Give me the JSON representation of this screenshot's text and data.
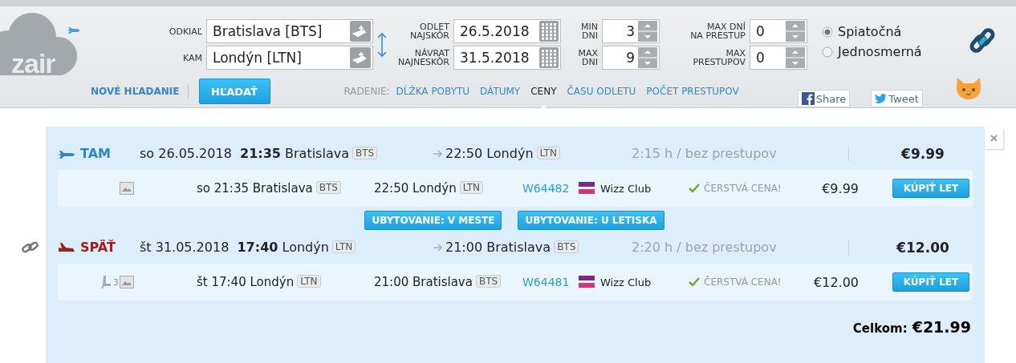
{
  "logo": {
    "text": "zair"
  },
  "route": [
    {
      "label": "ODKIAĽ",
      "value": "Bratislava [BTS]"
    },
    {
      "label": "KAM",
      "value": "Londýn [LTN]"
    }
  ],
  "dates": [
    {
      "label_lines": [
        "ODLET",
        "NAJSKÔR"
      ],
      "value": "26.5.2018"
    },
    {
      "label_lines": [
        "NÁVRAT",
        "NAJNESKÔR"
      ],
      "value": "31.5.2018"
    }
  ],
  "days": [
    {
      "label_lines": [
        "MIN",
        "DNI"
      ],
      "value": "3"
    },
    {
      "label_lines": [
        "MAX",
        "DNI"
      ],
      "value": "9"
    }
  ],
  "transfers": [
    {
      "label_lines": [
        "MAX DNÍ",
        "NA PRESTUP"
      ],
      "value": "0"
    },
    {
      "label_lines": [
        "MAX",
        "PRESTUPOV"
      ],
      "value": "0"
    }
  ],
  "trip_type": [
    {
      "label": "Spiatočná",
      "selected": true
    },
    {
      "label": "Jednosmerná",
      "selected": false
    }
  ],
  "new_search": "NOVÉ HĽADANIE",
  "search_button": "HĽADAŤ",
  "sorting": {
    "label": "RADENIE:",
    "options": [
      {
        "label": "DĹŽKA POBYTU",
        "selected": false
      },
      {
        "label": "DÁTUMY",
        "selected": false
      },
      {
        "label": "CENY",
        "selected": true
      },
      {
        "label": "ČASU ODLETU",
        "selected": false
      },
      {
        "label": "POČET PRESTUPOV",
        "selected": false
      }
    ]
  },
  "share": {
    "facebook": "Share",
    "twitter": "Tweet"
  },
  "results": {
    "close": "×",
    "items": [
      {
        "kind": "leg",
        "outbound": true,
        "label": "TAM",
        "date": "so 26.05.2018",
        "time": "21:35",
        "from": "Bratislava",
        "from_code": "BTS",
        "arrival": "22:50 Londýn",
        "to_code": "LTN",
        "duration": "2:15 h / bez prestupov",
        "price": "€9.99",
        "flights": [
          {
            "departure": "so 21:35 Bratislava",
            "from_code": "BTS",
            "arrival": "22:50 Londýn",
            "to_code": "LTN",
            "flight_no": "W64482",
            "airline": "Wizz Club",
            "status": "ČERSTVÁ CENA!",
            "price": "€9.99",
            "buy": "KÚPIŤ LET"
          }
        ]
      },
      {
        "kind": "accommodation",
        "buttons": [
          "UBYTOVANIE: V MESTE",
          "UBYTOVANIE: U LETISKA"
        ]
      },
      {
        "kind": "leg",
        "outbound": false,
        "label": "SPÄŤ",
        "date": "št 31.05.2018",
        "time": "17:40",
        "from": "Londýn",
        "from_code": "LTN",
        "arrival": "21:00 Bratislava",
        "to_code": "BTS",
        "duration": "2:20 h / bez prestupov",
        "price": "€12.00",
        "flights": [
          {
            "seats": "3",
            "departure": "št 17:40 Londýn",
            "from_code": "LTN",
            "arrival": "21:00 Bratislava",
            "to_code": "BTS",
            "flight_no": "W64481",
            "airline": "Wizz Club",
            "status": "ČERSTVÁ CENA!",
            "price": "€12.00",
            "buy": "KÚPIŤ LET"
          }
        ]
      }
    ],
    "total_label": "Celkom:",
    "total": "€21.99"
  }
}
